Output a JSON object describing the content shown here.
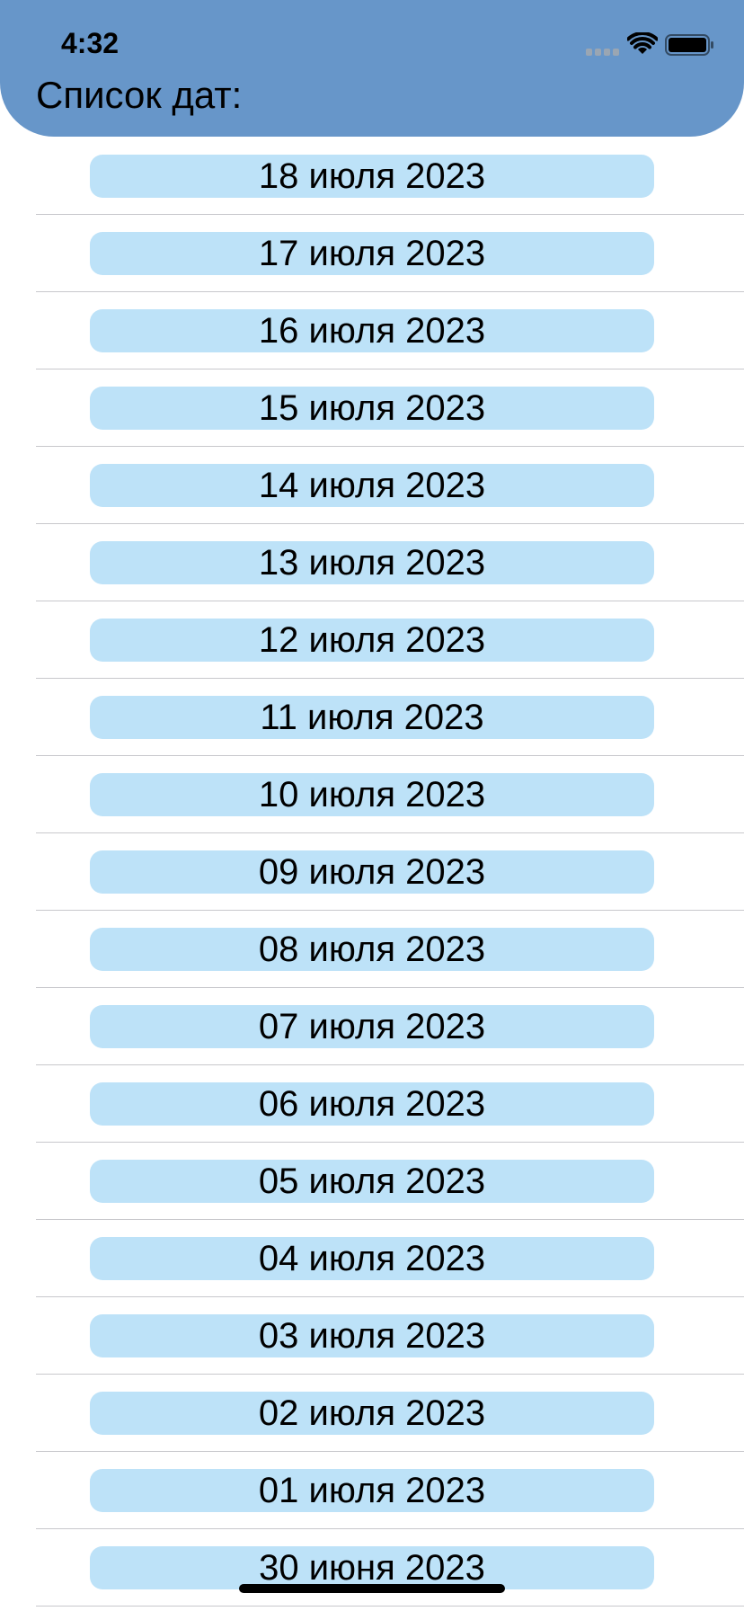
{
  "status_bar": {
    "time": "4:32",
    "icons": [
      "cellular-signal-icon",
      "wifi-icon",
      "battery-icon"
    ]
  },
  "header": {
    "title": "Список дат:",
    "background_color": "#6796c9"
  },
  "list": {
    "pill_color": "#bde2f8",
    "items": [
      "18 июля 2023",
      "17 июля 2023",
      "16 июля 2023",
      "15 июля 2023",
      "14 июля 2023",
      "13 июля 2023",
      "12 июля 2023",
      "11 июля 2023",
      "10 июля 2023",
      "09 июля 2023",
      "08 июля 2023",
      "07 июля 2023",
      "06 июля 2023",
      "05 июля 2023",
      "04 июля 2023",
      "03 июля 2023",
      "02 июля 2023",
      "01 июля 2023",
      "30 июня 2023"
    ]
  }
}
